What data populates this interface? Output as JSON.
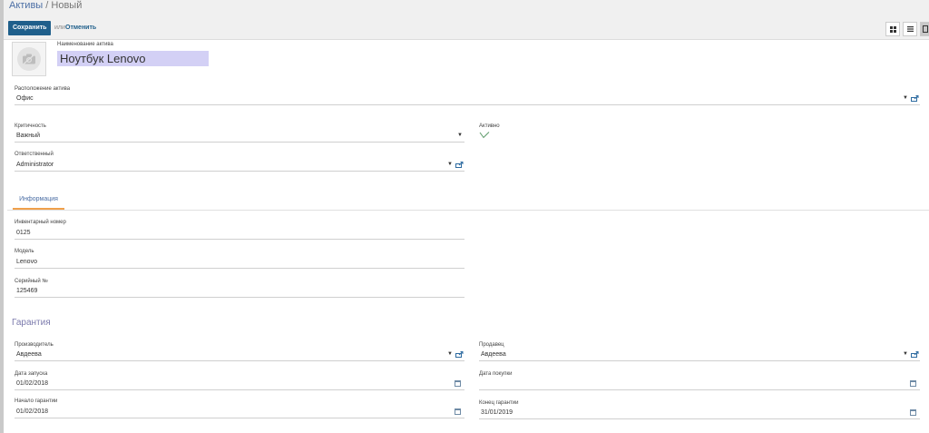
{
  "breadcrumb": {
    "parent": "Активы",
    "separator": " / ",
    "current": "Новый"
  },
  "toolbar": {
    "save_label": "Сохранить",
    "or_label": "или",
    "discard_label": "Отменить"
  },
  "form": {
    "name_label": "Наименование актива",
    "name_value": "Ноутбук Lenovo",
    "location": {
      "label": "Расположение актива",
      "value": "Офис"
    },
    "criticality": {
      "label": "Критичность",
      "value": "Важный"
    },
    "responsible": {
      "label": "Ответственный",
      "value": "Administrator"
    },
    "active": {
      "label": "Активно",
      "checked": true
    }
  },
  "tabs": [
    {
      "label": "Информация"
    }
  ],
  "info": {
    "inventory": {
      "label": "Инвентарный номер",
      "value": "0125"
    },
    "model": {
      "label": "Модель",
      "value": "Lenovo"
    },
    "serial": {
      "label": "Серийный №",
      "value": "125469"
    }
  },
  "warranty": {
    "title": "Гарантия",
    "manufacturer": {
      "label": "Производитель",
      "value": "Авдеева"
    },
    "vendor": {
      "label": "Продавец",
      "value": "Авдеева"
    },
    "start_date": {
      "label": "Дата запуска",
      "value": "01/02/2018"
    },
    "purchase_date": {
      "label": "Дата покупки",
      "value": ""
    },
    "warranty_start": {
      "label": "Начало гарантии",
      "value": "01/02/2018"
    },
    "warranty_end": {
      "label": "Конец гарантии",
      "value": "31/01/2019"
    }
  },
  "colors": {
    "primary": "#1f5f8b",
    "link": "#4c6fa5",
    "accent": "#f0a04b",
    "section": "#7c7bad",
    "highlight": "#d3d0f5"
  }
}
